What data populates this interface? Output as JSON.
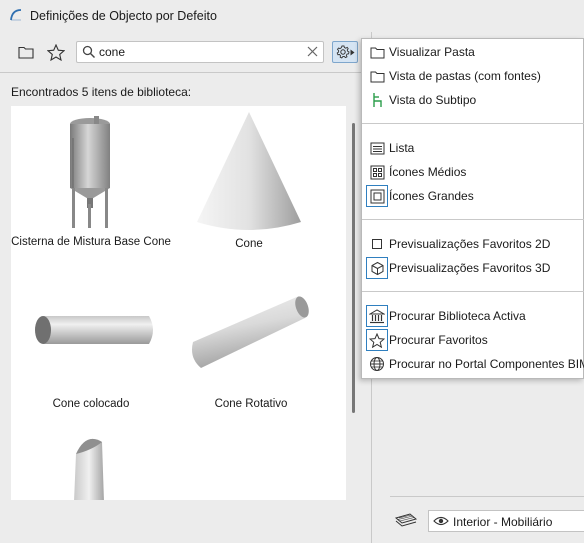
{
  "window": {
    "title": "Definições de Objecto por Defeito"
  },
  "search": {
    "value": "cone",
    "placeholder": ""
  },
  "results": {
    "found_text": "Encontrados 5 itens de biblioteca:",
    "items": [
      {
        "label": "Cisterna de Mistura Base Cone"
      },
      {
        "label": "Cone"
      },
      {
        "label": "Cone colocado"
      },
      {
        "label": "Cone Rotativo"
      },
      {
        "label": ""
      }
    ]
  },
  "menu": {
    "items": [
      {
        "label": "Visualizar Pasta",
        "icon": "folder-icon"
      },
      {
        "label": "Vista de pastas (com fontes)",
        "icon": "folder-icon"
      },
      {
        "label": "Vista do Subtipo",
        "icon": "subtype-icon"
      },
      {
        "label": "Lista",
        "icon": "list-icon"
      },
      {
        "label": "Ícones Médios",
        "icon": "medium-icons-icon"
      },
      {
        "label": "Ícones Grandes",
        "icon": "large-icons-icon",
        "selected": true
      },
      {
        "label": "Previsualizações Favoritos 2D",
        "icon": "preview-2d-icon"
      },
      {
        "label": "Previsualizações Favoritos 3D",
        "icon": "preview-3d-icon",
        "selected": true
      },
      {
        "label": "Procurar Biblioteca Activa",
        "icon": "library-icon",
        "selected": true
      },
      {
        "label": "Procurar Favoritos",
        "icon": "star-icon",
        "selected": true
      },
      {
        "label": "Procurar no Portal Componentes BIM",
        "icon": "globe-icon"
      }
    ]
  },
  "bottom": {
    "layer_value": "Interior - Mobiliário"
  },
  "colors": {
    "accent": "#2f7fbf",
    "selected_bg": "#d5e4f3",
    "subtype_green": "#2a9d4a"
  }
}
